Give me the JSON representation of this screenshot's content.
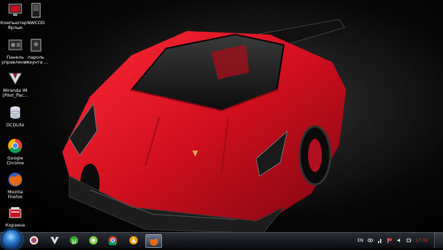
{
  "desktop": {
    "icons": [
      {
        "label": "Компьютер - Ярлык",
        "icon": "computer-icon"
      },
      {
        "label": "NWCOD",
        "icon": "nwcod-icon"
      },
      {
        "label": "Панель управления",
        "icon": "control-panel-icon"
      },
      {
        "label": "пароль акаунта ...",
        "icon": "password-icon"
      },
      {
        "label": "Miranda IM [Pilot_Pac...",
        "icon": "miranda-icon"
      },
      {
        "label": "DCDLite",
        "icon": "database-icon"
      },
      {
        "label": "Google Chrome",
        "icon": "chrome-icon"
      },
      {
        "label": "Mozilla Firefox",
        "icon": "firefox-icon"
      },
      {
        "label": "Корзина",
        "icon": "recycle-bin-icon"
      }
    ]
  },
  "taskbar": {
    "apps": [
      {
        "icon": "media-player-icon"
      },
      {
        "icon": "miranda-icon"
      },
      {
        "icon": "utorrent-icon"
      },
      {
        "icon": "icq-icon"
      },
      {
        "icon": "chrome-icon"
      },
      {
        "icon": "aimp-icon"
      },
      {
        "icon": "firefox-icon",
        "active": true
      }
    ],
    "tray": {
      "language": "EN",
      "clock": "17:32"
    }
  },
  "colors": {
    "accent": "#d9121f",
    "taskbar": "#1a1d22"
  }
}
